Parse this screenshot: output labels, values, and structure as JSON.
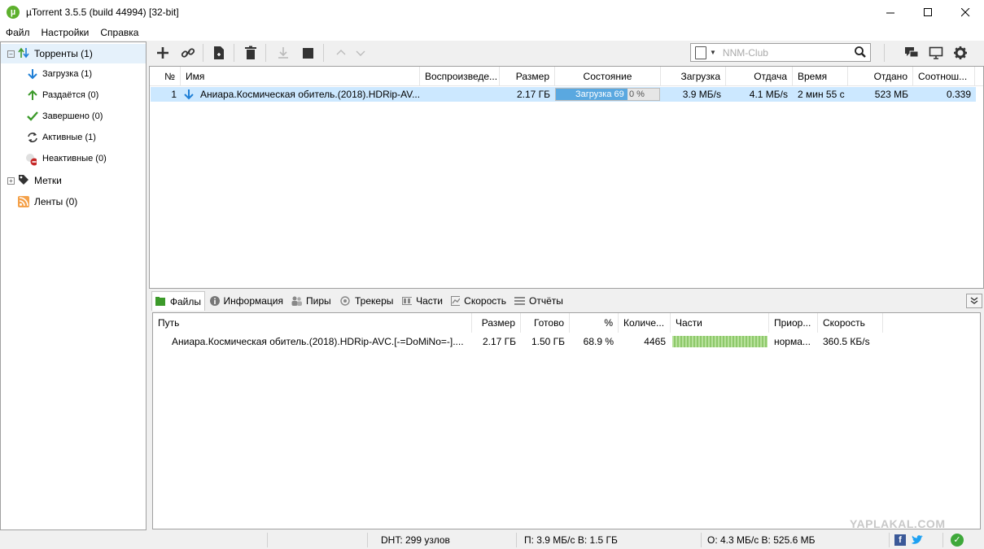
{
  "window": {
    "title": "µTorrent 3.5.5  (build 44994) [32-bit]",
    "controls": {
      "minimize": "—",
      "maximize": "☐",
      "close": "✕"
    }
  },
  "menu": {
    "items": [
      "Файл",
      "Настройки",
      "Справка"
    ]
  },
  "sidebar": {
    "torrents": {
      "label": "Торренты (1)",
      "expander": "−"
    },
    "items": [
      {
        "label": "Загрузка (1)",
        "icon": "download-arrow-icon",
        "color": "#1f7fd6"
      },
      {
        "label": "Раздаётся (0)",
        "icon": "upload-arrow-icon",
        "color": "#3c9a2a"
      },
      {
        "label": "Завершено (0)",
        "icon": "checkmark-icon",
        "color": "#3c9a2a"
      },
      {
        "label": "Активные (1)",
        "icon": "refresh-icon",
        "color": "#333333"
      },
      {
        "label": "Неактивные (0)",
        "icon": "inactive-icon",
        "color": "#c62828"
      }
    ],
    "labels": {
      "label": "Метки",
      "expander": "+"
    },
    "feeds": {
      "label": "Ленты (0)"
    }
  },
  "toolbar": {
    "search_placeholder": "NNM-Club"
  },
  "torrent_list": {
    "columns": [
      "№",
      "Имя",
      "Воспроизведе...",
      "Размер",
      "Состояние",
      "Загрузка",
      "Отдача",
      "Время",
      "Отдано",
      "Соотнош..."
    ],
    "rows": [
      {
        "num": "1",
        "name": "Аниара.Космическая обитель.(2018).HDRip-AV...",
        "size": "2.17 ГБ",
        "status_text": "Загрузка 69",
        "status_rest": "0 %",
        "progress": 0.69,
        "download": "3.9 МБ/s",
        "upload": "4.1 МБ/s",
        "time": "2 мин 55 с",
        "uploaded": "523 МБ",
        "ratio": "0.339"
      }
    ]
  },
  "tabs": [
    {
      "label": "Файлы",
      "icon": "files-icon",
      "active": true
    },
    {
      "label": "Информация",
      "icon": "info-icon"
    },
    {
      "label": "Пиры",
      "icon": "peers-icon"
    },
    {
      "label": "Трекеры",
      "icon": "trackers-icon"
    },
    {
      "label": "Части",
      "icon": "pieces-icon"
    },
    {
      "label": "Скорость",
      "icon": "speed-icon"
    },
    {
      "label": "Отчёты",
      "icon": "logger-icon"
    }
  ],
  "files": {
    "columns": [
      "Путь",
      "Размер",
      "Готово",
      "%",
      "Количе...",
      "Части",
      "Приор...",
      "Скорость"
    ],
    "rows": [
      {
        "path": "Аниара.Космическая обитель.(2018).HDRip-AVC.[-=DoMiNo=-]....",
        "size": "2.17 ГБ",
        "done": "1.50 ГБ",
        "percent": "68.9 %",
        "count": "4465",
        "priority": "норма...",
        "speed": "360.5 КБ/s"
      }
    ]
  },
  "watermark": "YAPLAKAL.COM",
  "statusbar": {
    "dht": "DHT: 299 узлов",
    "download": "П: 3.9 МБ/с В: 1.5 ГБ",
    "upload": "О: 4.3 МБ/с В: 525.6 МБ"
  },
  "colors": {
    "selection": "#cce8ff",
    "progress": "#5aa8e0",
    "accent_green": "#5db02d"
  }
}
